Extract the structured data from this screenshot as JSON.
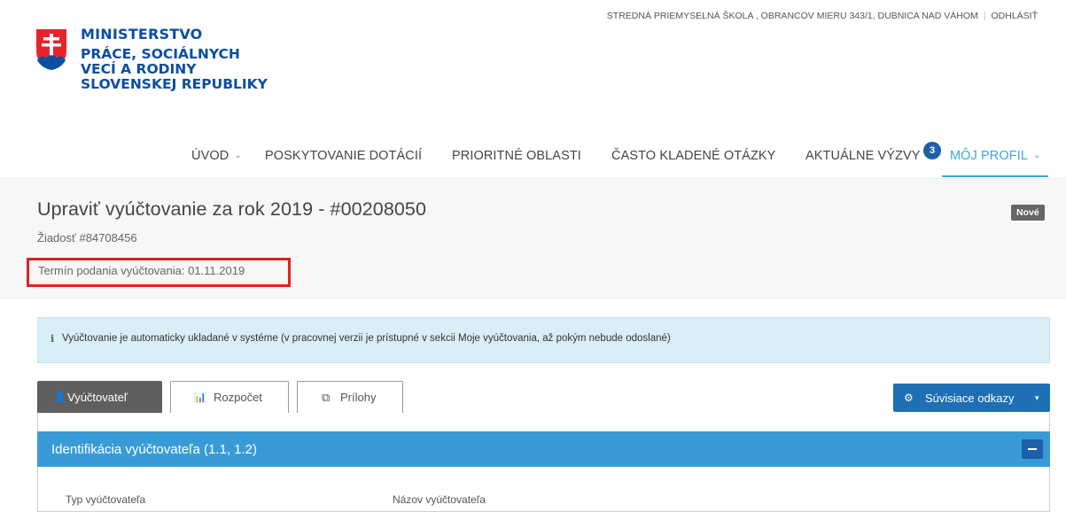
{
  "header": {
    "ministry_line1": "MINISTERSTVO",
    "ministry_line2": "PRÁCE, SOCIÁLNYCH",
    "ministry_line3": "VECÍ A RODINY",
    "ministry_line4": "SLOVENSKEJ REPUBLIKY",
    "logo_icon": "slovak-coat-of-arms-icon",
    "user_org": "STREDNÁ PRIEMYSELNÁ ŠKOLA , OBRANCOV MIERU 343/1, DUBNICA NAD VÁHOM",
    "separator": "|",
    "logout_label": "ODHLÁSIŤ"
  },
  "nav": {
    "items": [
      {
        "label": "ÚVOD",
        "has_dropdown": true
      },
      {
        "label": "POSKYTOVANIE DOTÁCIÍ"
      },
      {
        "label": "PRIORITNÉ OBLASTI"
      },
      {
        "label": "ČASTO KLADENÉ OTÁZKY"
      },
      {
        "label": "AKTUÁLNE VÝZVY",
        "badge": "3"
      },
      {
        "label": "MÔJ PROFIL",
        "has_dropdown": true,
        "active": true
      }
    ],
    "chevron": "⌄",
    "accent_color": "#3ea6dd"
  },
  "page": {
    "title": "Upraviť vyúčtovanie za rok 2019 - #00208050",
    "request": "Žiadosť #84708456",
    "deadline": "Termín podania vyúčtovania: 01.11.2019",
    "status": "Nové",
    "highlight_color": "#e02020"
  },
  "alert": {
    "icon": "info-icon",
    "icon_glyph": "i",
    "text": "Vyúčtovanie je automaticky ukladané v systéme (v pracovnej verzii je prístupné v sekcii Moje vyúčtovania, až pokým nebude odoslané)"
  },
  "tabs": [
    {
      "label": "Vyúčtovateľ",
      "icon": "user-icon",
      "glyph": "👤",
      "active": true
    },
    {
      "label": "Rozpočet",
      "icon": "bar-chart-icon",
      "glyph": "📊"
    },
    {
      "label": "Prílohy",
      "icon": "files-icon",
      "glyph": "⧉"
    }
  ],
  "related_links": {
    "label": "Súvisiace odkazy",
    "icon": "cogs-icon",
    "glyph": "⚙",
    "caret": "▾",
    "color": "#1e6fb5"
  },
  "panel": {
    "title": "Identifikácia vyúčtovateľa (1.1, 1.2)",
    "header_color": "#399bd6",
    "fields": [
      {
        "label": "Typ vyúčtovateľa"
      },
      {
        "label": "Názov vyúčtovateľa"
      }
    ]
  }
}
